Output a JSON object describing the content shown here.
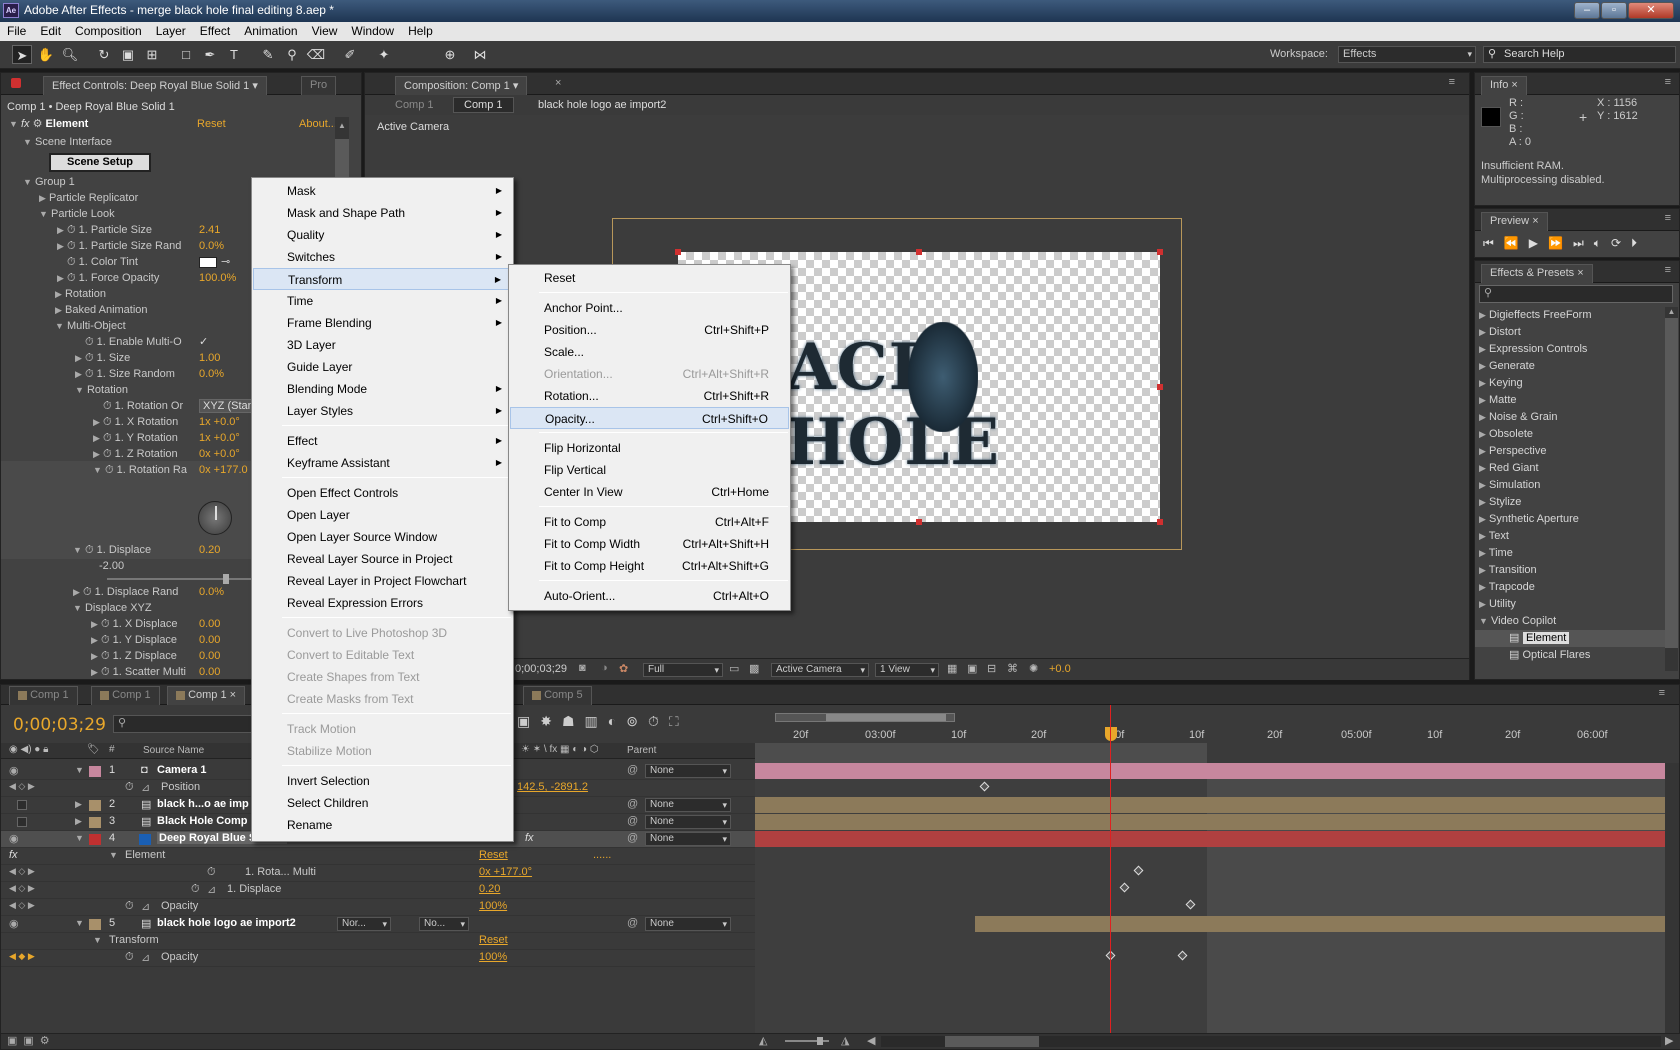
{
  "window": {
    "title": "Adobe After Effects - merge black hole final editing 8.aep *",
    "app_icon": "Ae"
  },
  "menu": [
    "File",
    "Edit",
    "Composition",
    "Layer",
    "Effect",
    "Animation",
    "View",
    "Window",
    "Help"
  ],
  "toolbar": {
    "workspace_label": "Workspace:",
    "workspace_value": "Effects",
    "search_placeholder": "Search Help"
  },
  "effect_controls": {
    "tab": "Effect Controls: Deep Royal Blue Solid 1",
    "tab2": "Pro",
    "crumb": "Comp 1 • Deep Royal Blue Solid 1",
    "effect": {
      "name": "Element",
      "reset": "Reset",
      "about": "About..."
    },
    "scene_interface": "Scene Interface",
    "scene_setup": "Scene Setup",
    "rows": [
      {
        "label": "Group 1",
        "value": ""
      },
      {
        "label": "Particle Replicator",
        "value": ""
      },
      {
        "label": "Particle Look",
        "value": ""
      },
      {
        "label": "1. Particle Size",
        "value": "2.41"
      },
      {
        "label": "1. Particle Size Rand",
        "value": "0.0%"
      },
      {
        "label": "1. Color Tint",
        "value": ""
      },
      {
        "label": "1. Force Opacity",
        "value": "100.0%"
      },
      {
        "label": "Rotation",
        "value": ""
      },
      {
        "label": "Baked Animation",
        "value": ""
      },
      {
        "label": "Multi-Object",
        "value": ""
      },
      {
        "label": "1. Enable Multi-O",
        "value": "✓"
      },
      {
        "label": "1. Size",
        "value": "1.00"
      },
      {
        "label": "1. Size Random",
        "value": "0.0%"
      },
      {
        "label": "Rotation",
        "value": ""
      },
      {
        "label": "1. Rotation Or",
        "value": "XYZ (Stan"
      },
      {
        "label": "1. X Rotation",
        "value": "1x +0.0°"
      },
      {
        "label": "1. Y Rotation",
        "value": "1x +0.0°"
      },
      {
        "label": "1. Z Rotation",
        "value": "0x +0.0°"
      },
      {
        "label": "1. Rotation Ra",
        "value": "0x +177.0"
      },
      {
        "label": "1. Displace",
        "value": "0.20"
      },
      {
        "label": "-2.00",
        "value": ""
      },
      {
        "label": "1. Displace Rand",
        "value": "0.0%"
      },
      {
        "label": "Displace XYZ",
        "value": ""
      },
      {
        "label": "1. X Displace",
        "value": "0.00"
      },
      {
        "label": "1. Y Displace",
        "value": "0.00"
      },
      {
        "label": "1. Z Displace",
        "value": "0.00"
      },
      {
        "label": "1. Scatter Multi",
        "value": "0.00"
      }
    ]
  },
  "composition": {
    "tab": "Composition: Comp 1",
    "crumbs": [
      "Comp 1",
      "Comp 1",
      "black hole logo ae import2"
    ],
    "camera_label": "Active Camera",
    "logo_text": "ACK HOLE",
    "footer": {
      "time": "0;00;03;29",
      "resolution": "Full",
      "camera": "Active Camera",
      "views": "1 View",
      "exposure": "+0.0"
    }
  },
  "context_menu": {
    "items": [
      {
        "label": "Mask",
        "sub": true,
        "disabled": false
      },
      {
        "label": "Mask and Shape Path",
        "sub": true,
        "disabled": false
      },
      {
        "label": "Quality",
        "sub": true,
        "disabled": false
      },
      {
        "label": "Switches",
        "sub": true,
        "disabled": false
      },
      {
        "label": "Transform",
        "sub": true,
        "disabled": false,
        "highlight": true
      },
      {
        "label": "Time",
        "sub": true,
        "disabled": false
      },
      {
        "label": "Frame Blending",
        "sub": true,
        "disabled": false
      },
      {
        "label": "3D Layer",
        "sub": false,
        "disabled": false
      },
      {
        "label": "Guide Layer",
        "sub": false,
        "disabled": false
      },
      {
        "label": "Blending Mode",
        "sub": true,
        "disabled": false
      },
      {
        "label": "Layer Styles",
        "sub": true,
        "disabled": false
      },
      {
        "sep": true
      },
      {
        "label": "Effect",
        "sub": true,
        "disabled": false
      },
      {
        "label": "Keyframe Assistant",
        "sub": true,
        "disabled": false
      },
      {
        "sep": true
      },
      {
        "label": "Open Effect Controls",
        "sub": false,
        "disabled": false
      },
      {
        "label": "Open Layer",
        "sub": false,
        "disabled": false
      },
      {
        "label": "Open Layer Source Window",
        "sub": false,
        "disabled": false
      },
      {
        "label": "Reveal Layer Source in Project",
        "sub": false,
        "disabled": false
      },
      {
        "label": "Reveal Layer in Project Flowchart",
        "sub": false,
        "disabled": false
      },
      {
        "label": "Reveal Expression Errors",
        "sub": false,
        "disabled": false
      },
      {
        "sep": true
      },
      {
        "label": "Convert to Live Photoshop 3D",
        "sub": false,
        "disabled": true
      },
      {
        "label": "Convert to Editable Text",
        "sub": false,
        "disabled": true
      },
      {
        "label": "Create Shapes from Text",
        "sub": false,
        "disabled": true
      },
      {
        "label": "Create Masks from Text",
        "sub": false,
        "disabled": true
      },
      {
        "sep": true
      },
      {
        "label": "Track Motion",
        "sub": false,
        "disabled": true
      },
      {
        "label": "Stabilize Motion",
        "sub": false,
        "disabled": true
      },
      {
        "sep": true
      },
      {
        "label": "Invert Selection",
        "sub": false,
        "disabled": false
      },
      {
        "label": "Select Children",
        "sub": false,
        "disabled": false
      },
      {
        "label": "Rename",
        "sub": false,
        "disabled": false
      }
    ]
  },
  "transform_submenu": {
    "items": [
      {
        "label": "Reset",
        "shortcut": ""
      },
      {
        "sep": true
      },
      {
        "label": "Anchor Point...",
        "shortcut": ""
      },
      {
        "label": "Position...",
        "shortcut": "Ctrl+Shift+P"
      },
      {
        "label": "Scale...",
        "shortcut": ""
      },
      {
        "label": "Orientation...",
        "shortcut": "Ctrl+Alt+Shift+R",
        "disabled": true
      },
      {
        "label": "Rotation...",
        "shortcut": "Ctrl+Shift+R"
      },
      {
        "label": "Opacity...",
        "shortcut": "Ctrl+Shift+O",
        "highlight": true
      },
      {
        "sep": true
      },
      {
        "label": "Flip Horizontal",
        "shortcut": ""
      },
      {
        "label": "Flip Vertical",
        "shortcut": ""
      },
      {
        "label": "Center In View",
        "shortcut": "Ctrl+Home"
      },
      {
        "sep": true
      },
      {
        "label": "Fit to Comp",
        "shortcut": "Ctrl+Alt+F"
      },
      {
        "label": "Fit to Comp Width",
        "shortcut": "Ctrl+Alt+Shift+H"
      },
      {
        "label": "Fit to Comp Height",
        "shortcut": "Ctrl+Alt+Shift+G"
      },
      {
        "sep": true
      },
      {
        "label": "Auto-Orient...",
        "shortcut": "Ctrl+Alt+O"
      }
    ]
  },
  "info": {
    "tab": "Info",
    "r": "R :",
    "g": "G :",
    "b": "B :",
    "a": "A : 0",
    "x": "X : 1156",
    "y": "Y : 1612",
    "msg1": "Insufficient RAM.",
    "msg2": "Multiprocessing disabled."
  },
  "preview": {
    "tab": "Preview"
  },
  "effects_presets": {
    "tab": "Effects & Presets",
    "items": [
      "Digieffects FreeForm",
      "Distort",
      "Expression Controls",
      "Generate",
      "Keying",
      "Matte",
      "Noise & Grain",
      "Obsolete",
      "Perspective",
      "Red Giant",
      "Simulation",
      "Stylize",
      "Synthetic Aperture",
      "Text",
      "Time",
      "Transition",
      "Trapcode",
      "Utility",
      "Video Copilot"
    ],
    "children": [
      "Element",
      "Optical Flares"
    ]
  },
  "timeline": {
    "tabs": [
      "Comp 1",
      "Comp 1",
      "Comp 1",
      "Comp 5"
    ],
    "time": "0;00;03;29",
    "col_source": "Source Name",
    "col_parent": "Parent",
    "ruler": [
      "20f",
      "03:00f",
      "10f",
      "20f",
      "00f",
      "10f",
      "20f",
      "05:00f",
      "10f",
      "20f",
      "06:00f"
    ],
    "rows": [
      {
        "num": "1",
        "name": "Camera 1",
        "parent": "None"
      },
      {
        "name": "Position",
        "value": "142.5, -2891.2"
      },
      {
        "num": "2",
        "name": "black h...o ae imp",
        "parent": "None"
      },
      {
        "num": "3",
        "name": "Black Hole Comp",
        "parent": "None"
      },
      {
        "num": "4",
        "name": "Deep Royal Blue Solid 1",
        "parent": "None"
      },
      {
        "name": "Element",
        "value": "Reset",
        "extra": "......"
      },
      {
        "name": "1. Rota... Multi",
        "value": "0x +177.0°"
      },
      {
        "name": "1. Displace",
        "value": "0.20"
      },
      {
        "name": "Opacity",
        "value": "100%"
      },
      {
        "num": "5",
        "name": "black hole logo ae import2",
        "mode": "Nor...",
        "trk": "No...",
        "parent": "None"
      },
      {
        "name": "Transform",
        "value": "Reset"
      },
      {
        "name": "Opacity",
        "value": "100%"
      }
    ]
  },
  "colors": {
    "accent": "#e8a72b",
    "camera_bar": "#c7879e",
    "layer_bar": "#8c7a5a",
    "solid_bar": "#b04040",
    "playhead": "#e02020"
  }
}
